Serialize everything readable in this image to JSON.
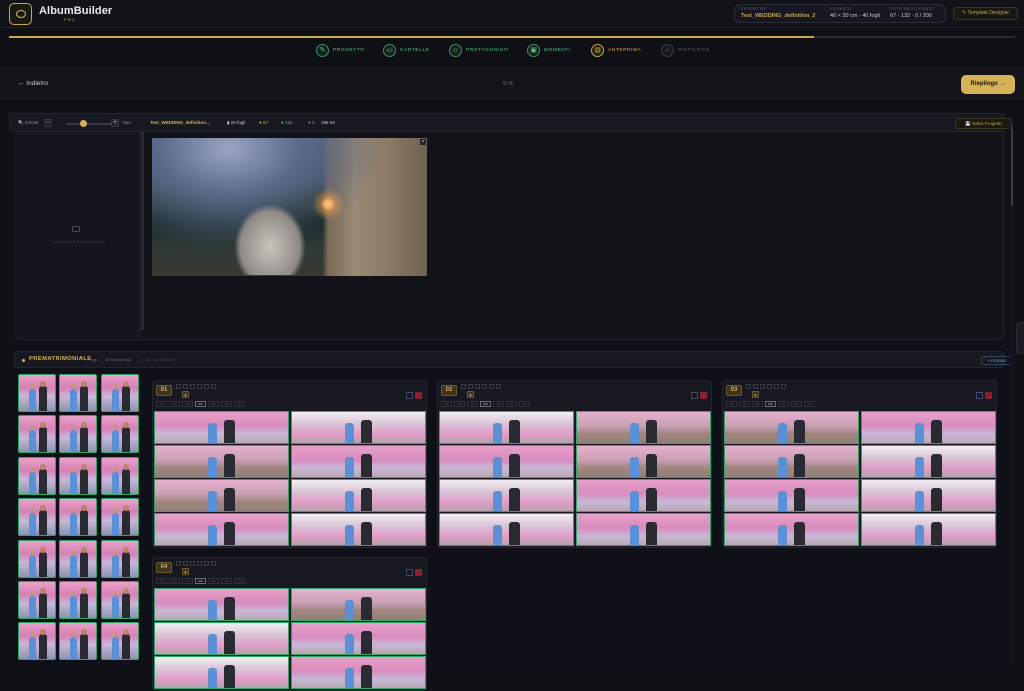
{
  "app": {
    "brand": "AlbumBuilder",
    "brand_sub": "PRO"
  },
  "project": {
    "label_project": "PROGETTO",
    "name": "Test_WEDDING_definition_2",
    "label_format": "FORMATO",
    "format": "40 × 30 cm · 40 fogli",
    "label_photos": "FOTO SELEZIONATE",
    "photos": "67 · 132 · 0 / 200"
  },
  "template_button": "✎ Template Designer",
  "progress": 0.8,
  "steps": [
    {
      "label": "PROGETTO",
      "icon": "✎",
      "state": "done"
    },
    {
      "label": "CARTELLE",
      "icon": "▭",
      "state": "done"
    },
    {
      "label": "PROTAGONISTI",
      "icon": "☺",
      "state": "done"
    },
    {
      "label": "MOMENTI",
      "icon": "▣",
      "state": "done"
    },
    {
      "label": "ANTEPRIMA",
      "icon": "▤",
      "state": "active"
    },
    {
      "label": "RIEPILOGO",
      "icon": "✓",
      "state": "pending"
    }
  ],
  "nav": {
    "back": "← Indietro",
    "page": "5 / 6",
    "next": "Riepilogo →"
  },
  "toolbar": {
    "zoom_label": "🔍 ZOOM",
    "zoom_minus": "−",
    "zoom_plus": "+",
    "zoom_value": "Tipo",
    "project_name": "Test_WEDDING_definition…",
    "sheets": "▮ 20 fogli",
    "stat1": "● 67",
    "stat2": "● 132",
    "stat3": "● 0",
    "total": "199 tot",
    "save": "💾 Salva Progetto"
  },
  "dropzone_text": "Trascina qui le foto dal pannello",
  "section": {
    "title": "PREMATRIMONIALE",
    "count": "7 fogli",
    "photos": "42 foto sui fogli",
    "extra": "4 foto non utilizzate",
    "add": "+ FOGLIO"
  },
  "spreads": [
    {
      "num": "01",
      "layouts": [
        "1/2",
        "2/2",
        "4/4",
        "6/6",
        "4/3",
        "2/3",
        "1/4"
      ]
    },
    {
      "num": "02",
      "layouts": [
        "1/2",
        "2/2",
        "4/4",
        "6/6",
        "4/3",
        "2/3",
        "1/4"
      ]
    },
    {
      "num": "03",
      "layouts": [
        "1/2",
        "2/2",
        "4/4",
        "6/6",
        "4/3",
        "2/3",
        "1/4"
      ]
    },
    {
      "num": "04",
      "layouts": [
        "1/2",
        "2/2",
        "4/4",
        "6/6",
        "4/3",
        "2/3",
        "1/4"
      ]
    }
  ],
  "colors": {
    "accent": "#d6b256",
    "success": "#2fa56a",
    "danger": "#8a2030",
    "bg": "#0f1016"
  }
}
